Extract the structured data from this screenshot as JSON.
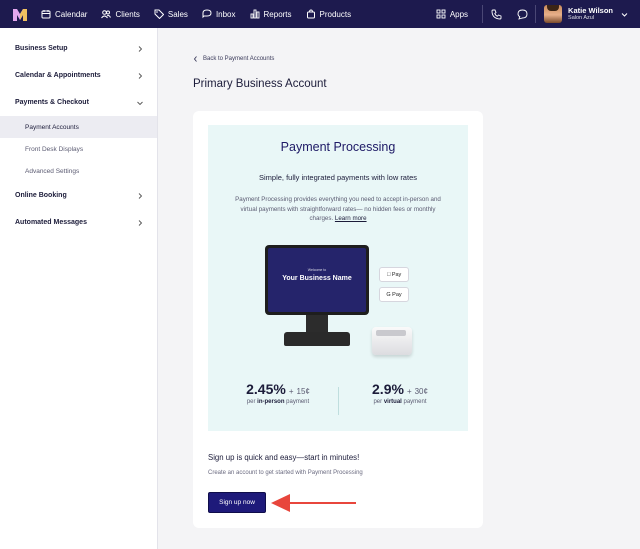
{
  "topbar": {
    "nav": [
      {
        "label": "Calendar",
        "icon": "calendar-icon"
      },
      {
        "label": "Clients",
        "icon": "clients-icon"
      },
      {
        "label": "Sales",
        "icon": "tag-icon"
      },
      {
        "label": "Inbox",
        "icon": "inbox-icon"
      },
      {
        "label": "Reports",
        "icon": "bar-chart-icon"
      },
      {
        "label": "Products",
        "icon": "bag-icon"
      }
    ],
    "apps_label": "Apps",
    "user": {
      "name": "Katie Wilson",
      "business": "Salon Azul"
    }
  },
  "sidebar": {
    "items": [
      {
        "label": "Business Setup"
      },
      {
        "label": "Calendar & Appointments"
      },
      {
        "label": "Payments & Checkout"
      },
      {
        "label": "Online Booking"
      },
      {
        "label": "Automated Messages"
      }
    ],
    "subitems": [
      {
        "label": "Payment Accounts"
      },
      {
        "label": "Front Desk Displays"
      },
      {
        "label": "Advanced Settings"
      }
    ]
  },
  "main": {
    "back_link": "Back to Payment Accounts",
    "title": "Primary Business Account"
  },
  "promo": {
    "title": "Payment Processing",
    "subtitle": "Simple, fully integrated payments with low rates",
    "description": "Payment Processing provides everything you need to accept in-person and virtual payments with straightforward rates— no hidden fees or monthly charges.",
    "learn_more": "Learn more",
    "terminal_welcome": "Welcome to",
    "terminal_name": "Your Business Name",
    "apple_pay": "Pay",
    "google_pay": "G Pay",
    "rates": [
      {
        "rate": "2.45%",
        "fee": "15¢",
        "label_prefix": "per",
        "label_bold": "in-person",
        "label_suffix": "payment"
      },
      {
        "rate": "2.9%",
        "fee": "30¢",
        "label_prefix": "per",
        "label_bold": "virtual",
        "label_suffix": "payment"
      }
    ]
  },
  "signup": {
    "heading": "Sign up is quick and easy—start in minutes!",
    "subtext": "Create an account to get started with Payment Processing",
    "button": "Sign up now"
  },
  "colors": {
    "topbar": "#1d1a4e",
    "accent": "#1e1a7a",
    "promo_bg": "#e9f7f7",
    "arrow": "#e8463c"
  }
}
